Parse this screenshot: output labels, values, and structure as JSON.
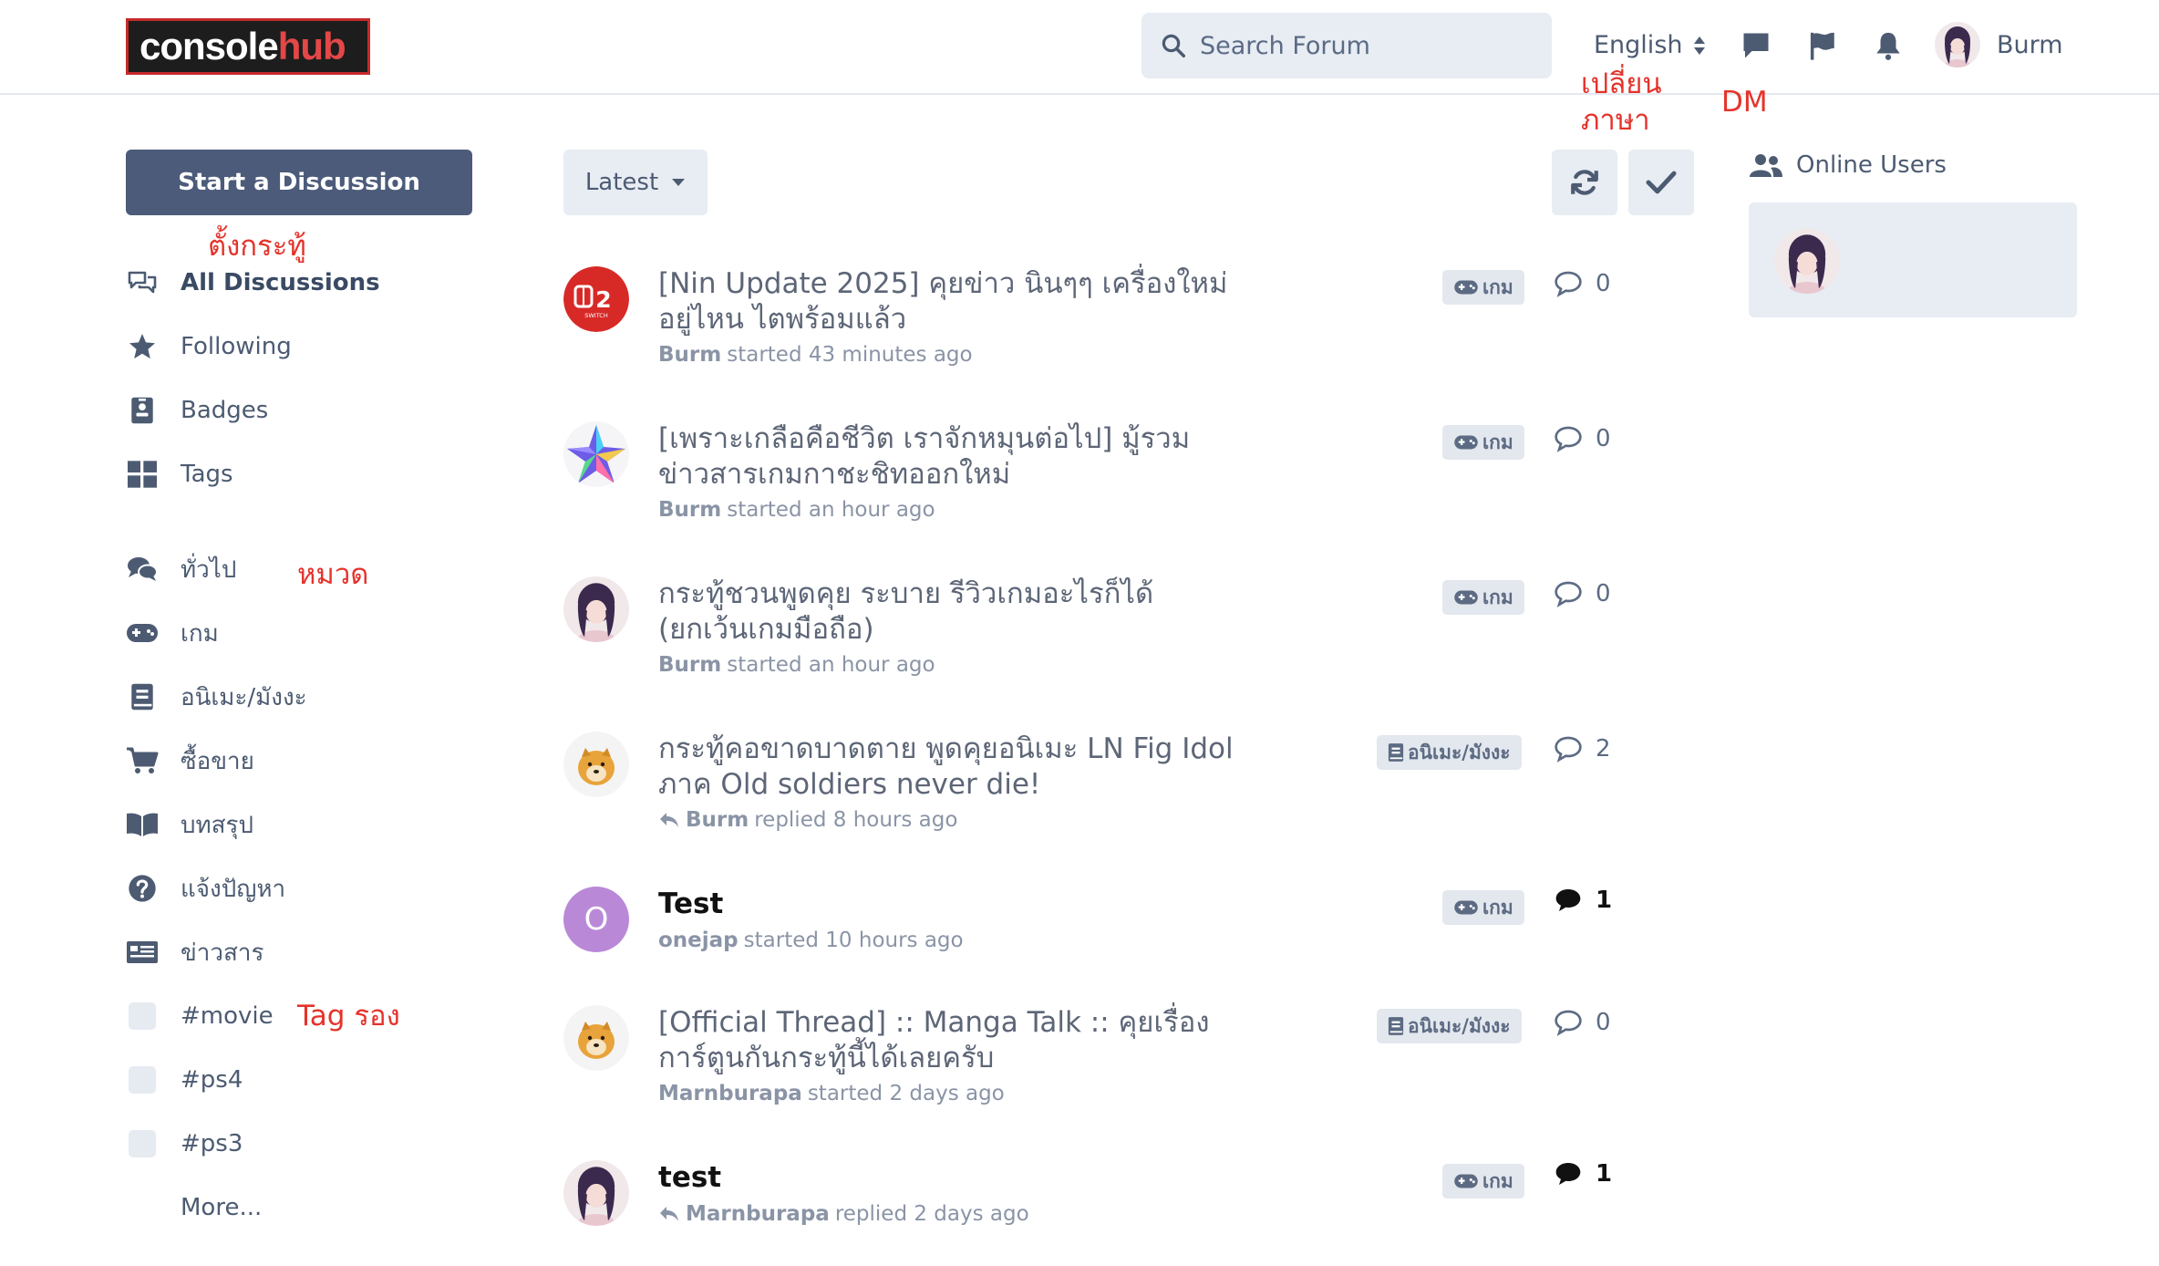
{
  "header": {
    "logo": {
      "part1": "console",
      "part2": "hub"
    },
    "search_placeholder": "Search Forum",
    "language": "English",
    "username": "Burm"
  },
  "annotations": {
    "language": "เปลี่ยน\nภาษา",
    "dm": "DM",
    "start": "ตั้งกระทู้",
    "categories": "หมวด",
    "subtags": "Tag รอง"
  },
  "sidebar": {
    "start_button": "Start a Discussion",
    "main_items": [
      {
        "label": "All Discussions",
        "icon": "discussions-icon"
      },
      {
        "label": "Following",
        "icon": "star-icon"
      },
      {
        "label": "Badges",
        "icon": "badge-icon"
      },
      {
        "label": "Tags",
        "icon": "tags-grid-icon"
      }
    ],
    "tag_items": [
      {
        "label": "ทั่วไป",
        "icon": "chat-bubbles-icon"
      },
      {
        "label": "เกม",
        "icon": "gamepad-icon"
      },
      {
        "label": "อนิเมะ/มังงะ",
        "icon": "book-icon"
      },
      {
        "label": "ซื้อขาย",
        "icon": "cart-icon"
      },
      {
        "label": "บทสรุป",
        "icon": "open-book-icon"
      },
      {
        "label": "แจ้งปัญหา",
        "icon": "question-icon"
      },
      {
        "label": "ข่าวสาร",
        "icon": "newspaper-icon"
      }
    ],
    "secondary_tags": [
      "#movie",
      "#ps4",
      "#ps3"
    ],
    "more": "More..."
  },
  "toolbar": {
    "sort_label": "Latest"
  },
  "online": {
    "title": "Online Users"
  },
  "discussions": [
    {
      "title": "[Nin Update 2025] คุยข่าว นินๆๆ เครื่องใหม่อยู่ไหน ไตพร้อมแล้ว",
      "user": "Burm",
      "action": "started 43 minutes ago",
      "replied": false,
      "tag": "เกม",
      "tag_icon": "gamepad-icon",
      "replies": "0",
      "unread": false,
      "avatar": "switch2-avatar"
    },
    {
      "title": "[เพราะเกลือคือชีวิต เราจักหมุนต่อไป] มู้รวมข่าวสารเกมกาชะชิทออกใหม่",
      "user": "Burm",
      "action": "started an hour ago",
      "replied": false,
      "tag": "เกม",
      "tag_icon": "gamepad-icon",
      "replies": "0",
      "unread": false,
      "avatar": "star-avatar"
    },
    {
      "title": "กระทู้ชวนพูดคุย ระบาย รีวิวเกมอะไรก็ได้ (ยกเว้นเกมมือถือ)",
      "user": "Burm",
      "action": "started an hour ago",
      "replied": false,
      "tag": "เกม",
      "tag_icon": "gamepad-icon",
      "replies": "0",
      "unread": false,
      "avatar": "anime-girl-avatar"
    },
    {
      "title": "กระทู้คอขาดบาดตาย พูดคุยอนิเมะ LN Fig Idol ภาค Old soldiers never die!",
      "user": "Burm",
      "action": "replied 8 hours ago",
      "replied": true,
      "tag": "อนิเมะ/มังงะ",
      "tag_icon": "book-icon",
      "replies": "2",
      "unread": false,
      "avatar": "doge-avatar"
    },
    {
      "title": "Test",
      "user": "onejap",
      "action": "started 10 hours ago",
      "replied": false,
      "tag": "เกม",
      "tag_icon": "gamepad-icon",
      "replies": "1",
      "unread": true,
      "avatar": "letter-avatar",
      "avatar_letter": "O",
      "avatar_color": "#b989d8"
    },
    {
      "title": "[Official Thread] :: Manga Talk :: คุยเรื่องการ์ตูนกันกระทู้นี้ได้เลยครับ",
      "user": "Marnburapa",
      "action": "started 2 days ago",
      "replied": false,
      "tag": "อนิเมะ/มังงะ",
      "tag_icon": "book-icon",
      "replies": "0",
      "unread": false,
      "avatar": "doge-avatar"
    },
    {
      "title": "test",
      "user": "Marnburapa",
      "action": "replied 2 days ago",
      "replied": true,
      "tag": "เกม",
      "tag_icon": "gamepad-icon",
      "replies": "1",
      "unread": true,
      "avatar": "anime-girl-avatar"
    }
  ],
  "colors": {
    "primary": "#4c5b7a",
    "annotation": "#e4332b",
    "surface": "#e8ecf3",
    "text": "#4c5b72"
  }
}
